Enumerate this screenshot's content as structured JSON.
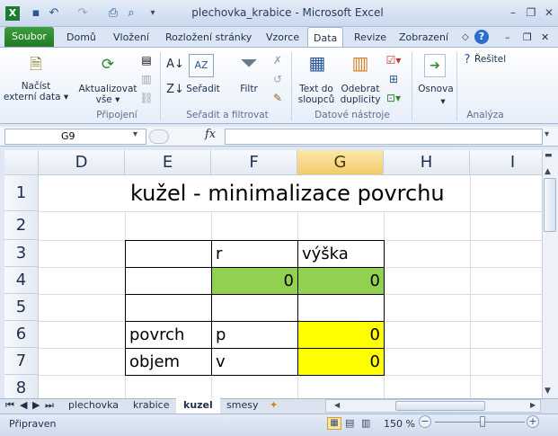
{
  "window": {
    "title": "plechovka_krabice - Microsoft Excel",
    "quick_access": [
      "excel-logo-icon",
      "save-icon",
      "undo-icon",
      "redo-icon",
      "print-icon",
      "print-preview-icon",
      "customize-icon"
    ],
    "controls": {
      "minimize": "–",
      "restore": "❐",
      "close": "✕"
    }
  },
  "ribbon_tabs": {
    "file": "Soubor",
    "items": [
      "Domů",
      "Vložení",
      "Rozložení stránky",
      "Vzorce",
      "Data",
      "Revize",
      "Zobrazení"
    ],
    "active": "Data"
  },
  "ribbon": {
    "get_external": "Načíst\nexterní data ▾",
    "refresh_all": "Aktualizovat\nvše ▾",
    "group_connections": "Připojení",
    "sort": "Seřadit",
    "filter": "Filtr",
    "group_sort_filter": "Seřadit a filtrovat",
    "text_to_columns": "Text do\nsloupců",
    "remove_duplicates": "Odebrat\nduplicity",
    "group_data_tools": "Datové nástroje",
    "outline": "Osnova",
    "solver": "Řešitel",
    "group_analysis": "Analýza"
  },
  "formula_bar": {
    "name_box": "G9",
    "fx": "fx",
    "value": ""
  },
  "sheet": {
    "columns": [
      "D",
      "E",
      "F",
      "G",
      "H",
      "I"
    ],
    "selected_column": "G",
    "rows": [
      "1",
      "2",
      "3",
      "4",
      "5",
      "6",
      "7",
      "8"
    ],
    "title": "kužel - minimalizace povrchu",
    "cells": {
      "F3": "r",
      "G3": "výška",
      "F4": "0",
      "G4": "0",
      "E6": "povrch",
      "F6": "p",
      "G6": "0",
      "E7": "objem",
      "F7": "v",
      "G7": "0"
    },
    "colors": {
      "green": "#92d050",
      "yellow": "#ffff00"
    }
  },
  "sheet_tabs": {
    "items": [
      "plechovka",
      "krabice",
      "kuzel",
      "smesy"
    ],
    "active": "kuzel"
  },
  "status": {
    "ready": "Připraven",
    "zoom": "150 %"
  }
}
